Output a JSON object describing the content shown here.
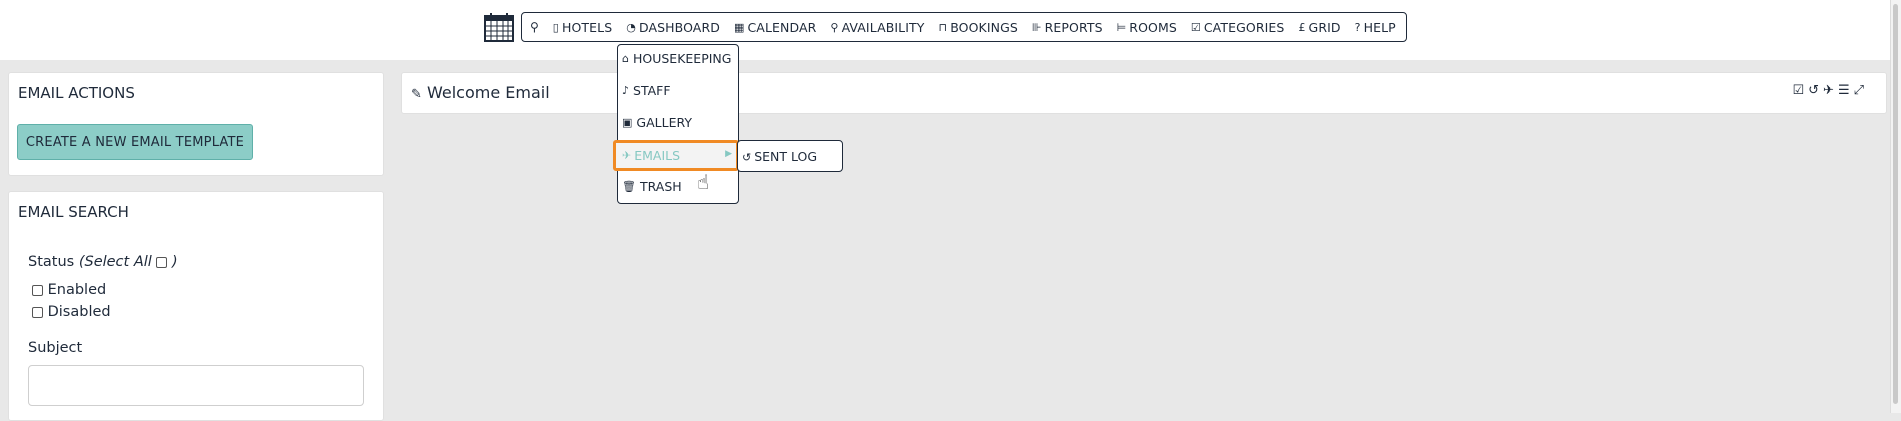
{
  "nav": {
    "items": [
      {
        "icon": "building-icon",
        "glyph": "▯",
        "label": "HOTELS"
      },
      {
        "icon": "dashboard-icon",
        "glyph": "◔",
        "label": "DASHBOARD"
      },
      {
        "icon": "calendar-icon",
        "glyph": "▦",
        "label": "CALENDAR"
      },
      {
        "icon": "search-icon",
        "glyph": "⚲",
        "label": "AVAILABILITY"
      },
      {
        "icon": "inbox-icon",
        "glyph": "⊓",
        "label": "BOOKINGS"
      },
      {
        "icon": "bar-chart-icon",
        "glyph": "⊪",
        "label": "REPORTS"
      },
      {
        "icon": "bed-icon",
        "glyph": "⊨",
        "label": "ROOMS"
      },
      {
        "icon": "check-square-icon",
        "glyph": "☑",
        "label": "CATEGORIES"
      },
      {
        "icon": "pound-icon",
        "glyph": "£",
        "label": "GRID"
      },
      {
        "icon": "question-icon",
        "glyph": "?",
        "label": "HELP"
      }
    ]
  },
  "dropdown": {
    "items": [
      {
        "icon": "home-icon",
        "glyph": "⌂",
        "label": "HOUSEKEEPING"
      },
      {
        "icon": "bell-icon",
        "glyph": "♪",
        "label": "STAFF"
      },
      {
        "icon": "image-icon",
        "glyph": "▣",
        "label": "GALLERY"
      },
      {
        "icon": "paper-plane-icon",
        "glyph": "✈",
        "label": "EMAILS"
      },
      {
        "icon": "trash-icon",
        "glyph": "🗑",
        "label": "TRASH"
      }
    ],
    "submenu": {
      "icon": "history-icon",
      "glyph": "↺",
      "label": "SENT LOG"
    }
  },
  "actions_panel": {
    "title": "EMAIL ACTIONS",
    "create_button": "CREATE A NEW EMAIL TEMPLATE"
  },
  "search_panel": {
    "title": "EMAIL SEARCH",
    "status_label": "Status",
    "select_all": "(Select All",
    "select_all_close": ")",
    "options": [
      "Enabled",
      "Disabled"
    ],
    "subject_label": "Subject",
    "subject_value": "",
    "subject_placeholder": ""
  },
  "main_panel": {
    "title": "Welcome Email"
  },
  "colors": {
    "accent": "#8ccdc7",
    "highlight": "#f08a24",
    "text": "#1f2a3a"
  }
}
